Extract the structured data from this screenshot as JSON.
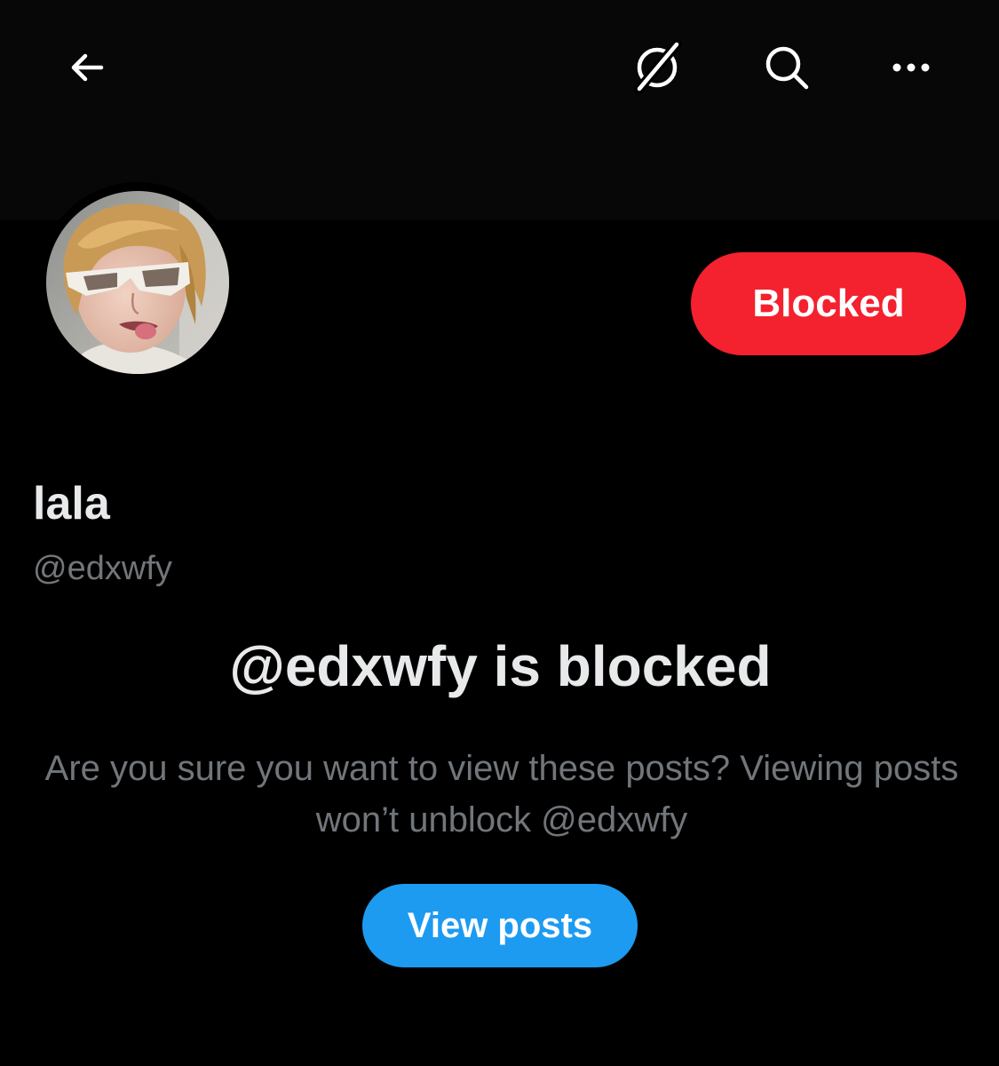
{
  "header": {
    "back_icon": "arrow-left-icon",
    "grok_icon": "grok-icon",
    "search_icon": "search-icon",
    "more_icon": "more-horizontal-icon"
  },
  "profile": {
    "display_name": "lala",
    "handle": "@edxwfy",
    "avatar_icon": "avatar-photo",
    "blocked_button_label": "Blocked"
  },
  "blocked_notice": {
    "title": "@edxwfy is blocked",
    "description": "Are you sure you want to view these posts? Viewing posts won’t unblock @edxwfy",
    "view_button_label": "View posts"
  },
  "colors": {
    "background": "#000000",
    "banner": "#070707",
    "blocked_red": "#f4212e",
    "view_blue": "#1d9bf0",
    "primary_text": "#e7e9ea",
    "secondary_text": "#71767b"
  }
}
